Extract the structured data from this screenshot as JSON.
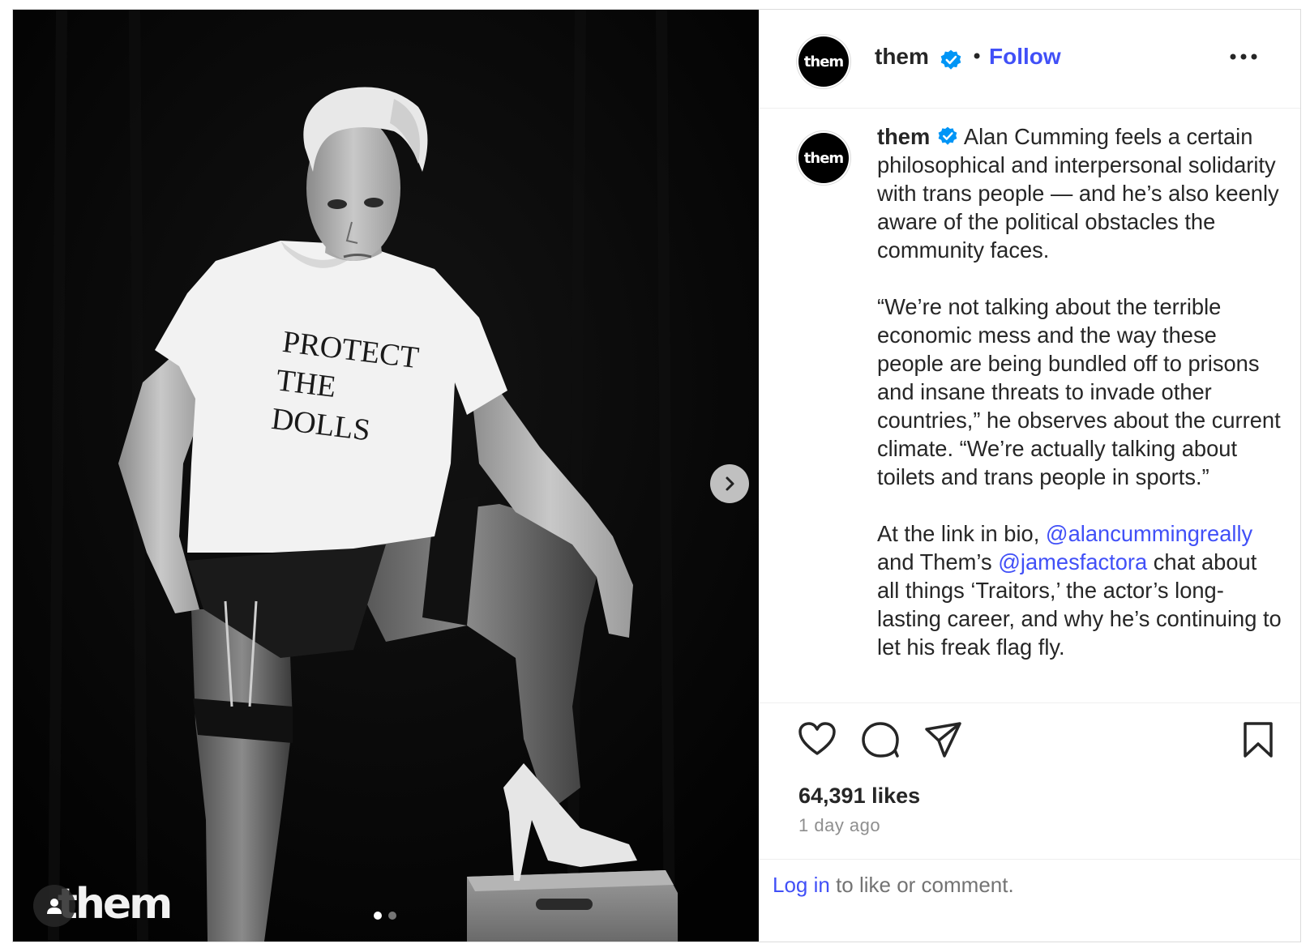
{
  "post": {
    "account": "them",
    "avatar_text": "them",
    "follow_label": "Follow",
    "separator": "•",
    "caption_paragraphs": [
      "Alan Cumming feels a certain philosophical and interpersonal solidarity with trans people — and he’s also keenly aware of the political obstacles the community faces.",
      "“We’re not talking about the terrible economic mess and the way these people are being bundled off to prisons and insane threats to invade other countries,” he observes about the current climate. “We’re actually talking about toilets and trans people in sports.”"
    ],
    "caption_last": {
      "part1": "At the link in bio, ",
      "mention1": "@alancummingreally",
      "part2": " and Them’s ",
      "mention2": "@jamesfactora",
      "part3": " chat about all things ‘Traitors,’ the actor’s long-lasting career, and why he’s continuing to let his freak flag fly."
    },
    "likes": "64,391 likes",
    "time_ago": "1 day ago"
  },
  "media": {
    "shirt_text": [
      "PROTECT",
      "THE",
      "DOLLS"
    ],
    "watermark": "them",
    "carousel_count": 2,
    "carousel_active": 1
  },
  "footer": {
    "login_link": "Log in",
    "login_rest": " to like or comment."
  },
  "colors": {
    "link_blue": "#4150f7",
    "verified_blue": "#0095f6",
    "text": "#262626",
    "muted": "#8e8e8e"
  },
  "icons": [
    "chevron-right-icon",
    "user-tag-icon",
    "verified-icon",
    "more-icon",
    "heart-icon",
    "comment-icon",
    "share-icon",
    "bookmark-icon"
  ]
}
